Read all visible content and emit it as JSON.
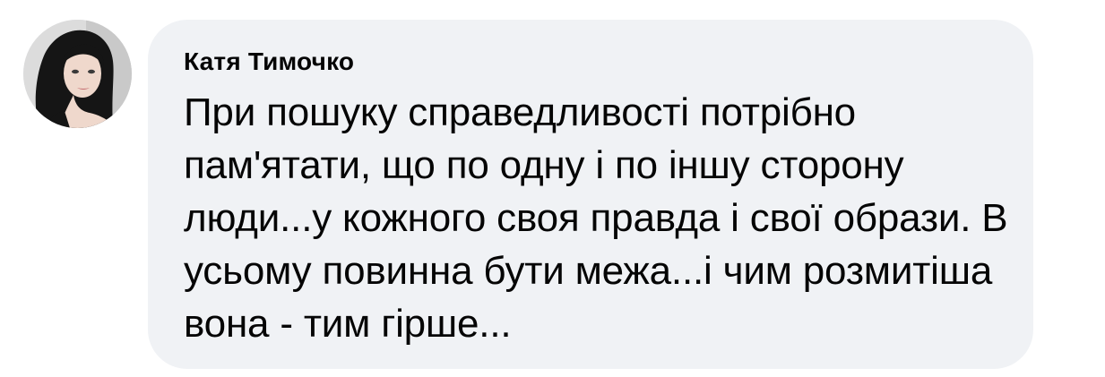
{
  "comment": {
    "author": "Катя Тимочко",
    "avatar_icon": "profile-photo",
    "text": "При пошуку справедливості потрібно пам'ятати, що по одну і по іншу сторону люди...у кожного своя правда і свої образи. В усьому повинна бути межа...і чим розмитіша вона - тим гірше..."
  },
  "colors": {
    "bubble_background": "#f0f2f5",
    "text": "#050505",
    "page_background": "#ffffff"
  }
}
